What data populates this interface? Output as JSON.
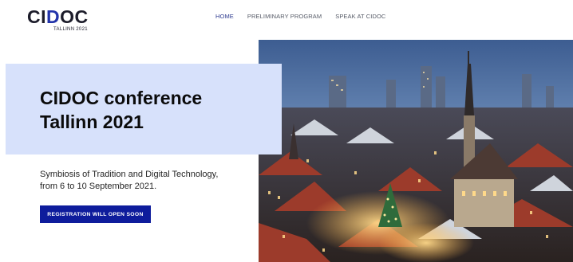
{
  "logo": {
    "wordmark_prefix": "CI",
    "wordmark_d": "D",
    "wordmark_suffix": "OC",
    "subtitle": "TALLINN 2021"
  },
  "nav": {
    "items": [
      "HOME",
      "PRELIMINARY PROGRAM",
      "SPEAK AT CIDOC"
    ],
    "active": "HOME"
  },
  "hero": {
    "title_line1": "CIDOC conference",
    "title_line2": "Tallinn 2021",
    "tagline_line1": "Symbiosis of Tradition and Digital Technology,",
    "tagline_line2": "from 6 to 10 September 2021.",
    "cta_label": "REGISTRATION WILL OPEN SOON"
  },
  "colors": {
    "accent": "#0e1c9c",
    "card_bg": "#d7e1fb",
    "nav_active": "#2f3c90"
  }
}
